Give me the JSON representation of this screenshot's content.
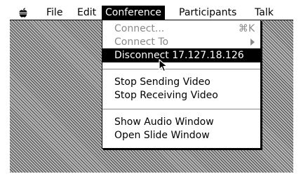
{
  "menubar": {
    "apple_icon": "apple-icon",
    "file": "File",
    "edit": "Edit",
    "conference": "Conference",
    "participants": "Participants",
    "talk": "Talk"
  },
  "conference_menu": {
    "connect": "Connect...",
    "connect_shortcut": "⌘K",
    "connect_to": "Connect To",
    "disconnect": "Disconnect 17.127.18.126",
    "stop_sending": "Stop Sending Video",
    "stop_receiving": "Stop Receiving Video",
    "show_audio": "Show Audio Window",
    "open_slide": "Open Slide Window"
  },
  "colors": {
    "menu_highlight": "#000000",
    "disabled_text": "#8a8a8a"
  },
  "cursor_icon": "arrow-pointer-icon"
}
